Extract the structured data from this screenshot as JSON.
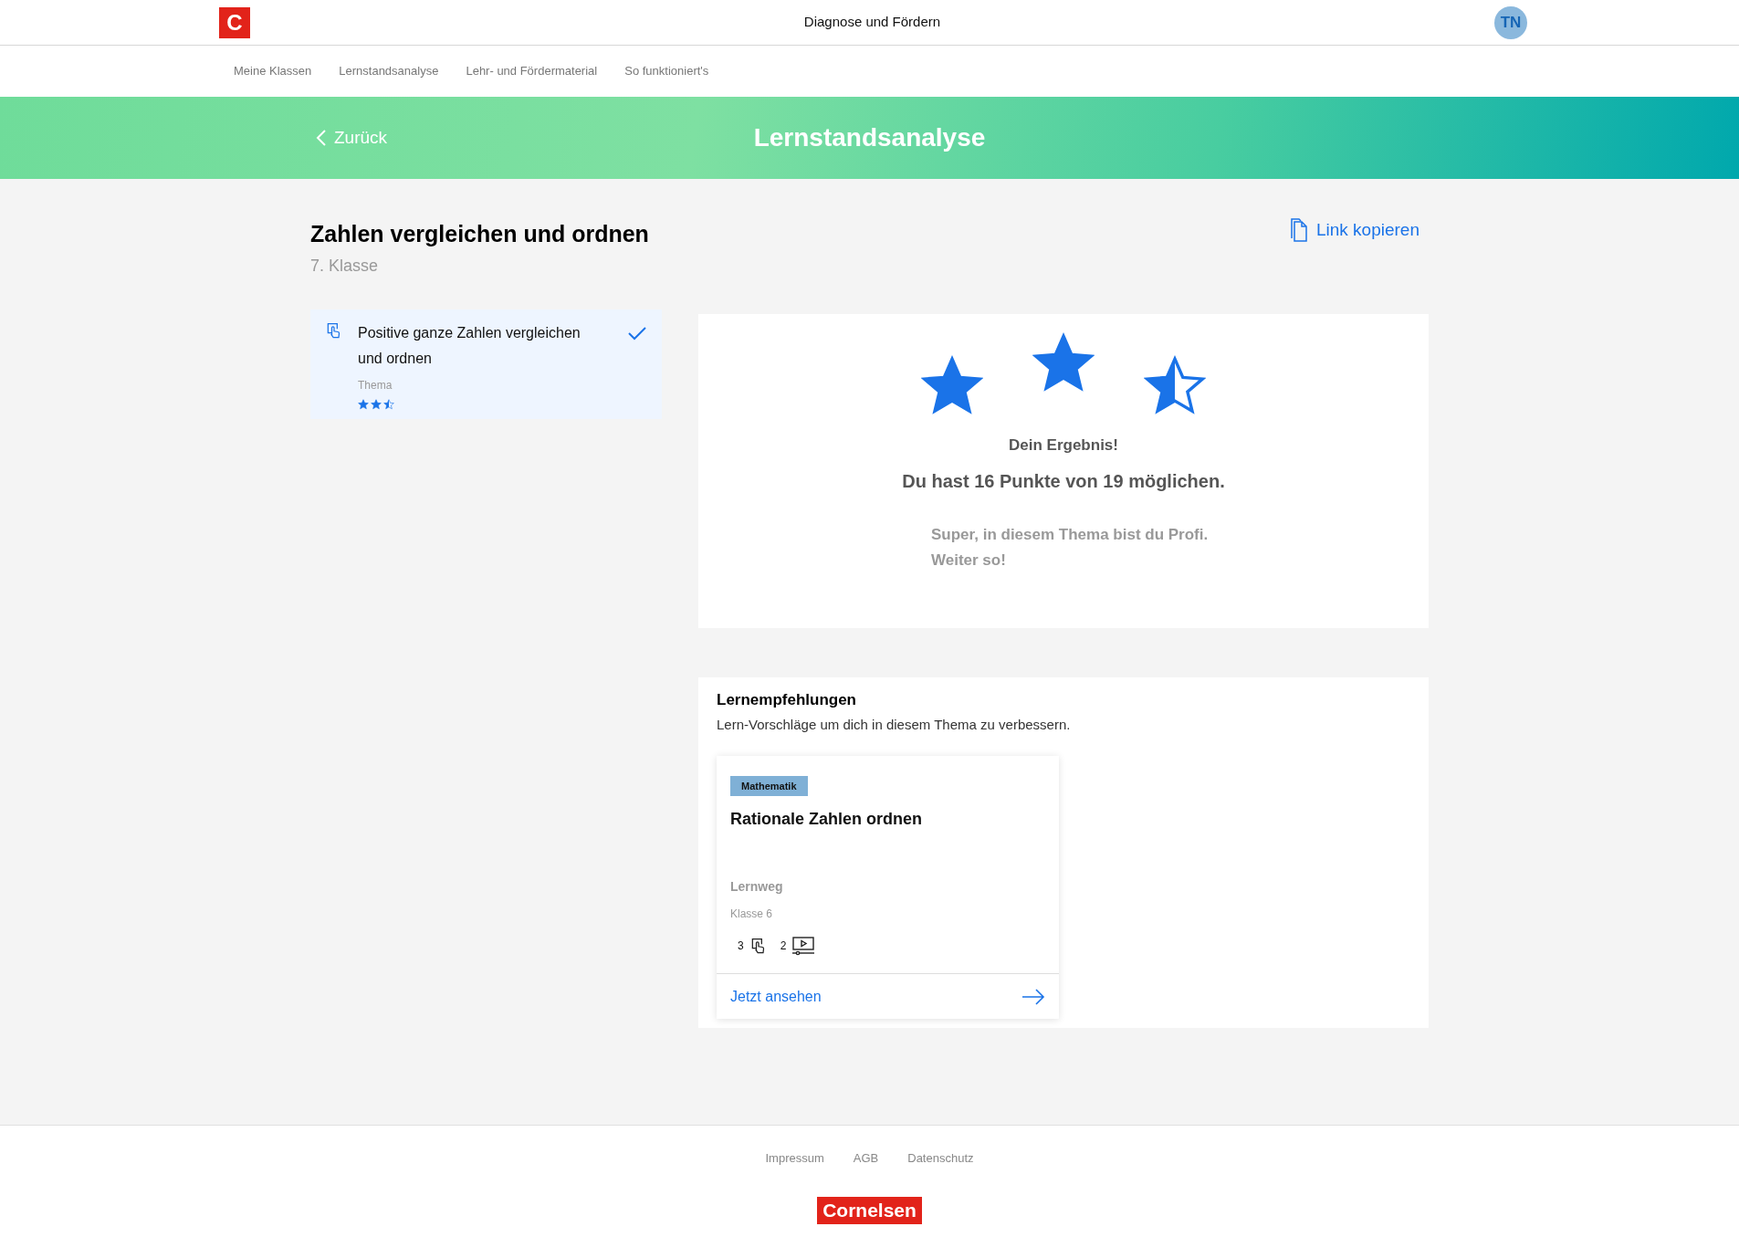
{
  "header": {
    "logo": "C",
    "title": "Diagnose und Fördern",
    "avatar": "TN"
  },
  "nav": [
    {
      "label": "Meine Klassen"
    },
    {
      "label": "Lernstandsanalyse"
    },
    {
      "label": "Lehr- und Fördermaterial"
    },
    {
      "label": "So funktioniert's"
    }
  ],
  "banner": {
    "back": "Zurück",
    "title": "Lernstandsanalyse"
  },
  "page": {
    "title": "Zahlen vergleichen und ordnen",
    "subtitle": "7. Klasse",
    "copy_link": "Link kopieren"
  },
  "topics": [
    {
      "title": "Positive ganze Zahlen vergleichen und ordnen",
      "type": "Thema",
      "stars": 2.5,
      "checked": true,
      "selected": true
    }
  ],
  "result": {
    "stars": 2.5,
    "heading": "Dein Ergebnis!",
    "score": "Du hast 16 Punkte von 19 möglichen.",
    "message": "Super, in diesem Thema bist du Profi. Weiter so!"
  },
  "recommendations": {
    "title": "Lernempfehlungen",
    "subtitle": "Lern-Vorschläge um dich in diesem Thema zu verbessern.",
    "cards": [
      {
        "tag": "Mathematik",
        "title": "Rationale Zahlen ordnen",
        "type": "Lernweg",
        "grade": "Klasse 6",
        "counts": [
          {
            "kind": "exercise",
            "count": "3"
          },
          {
            "kind": "video",
            "count": "2"
          }
        ],
        "action": "Jetzt ansehen"
      }
    ]
  },
  "footer": {
    "links": [
      "Impressum",
      "AGB",
      "Datenschutz"
    ],
    "logo": "Cornelsen"
  }
}
